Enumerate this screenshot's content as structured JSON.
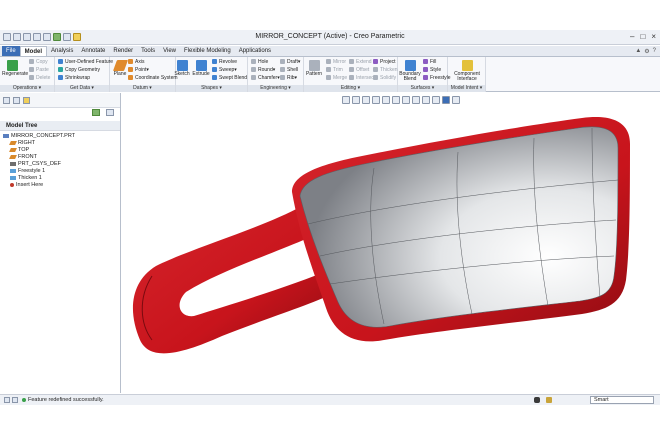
{
  "window": {
    "title": "MIRROR_CONCEPT (Active) - Creo Parametric"
  },
  "tabs": [
    {
      "label": "File"
    },
    {
      "label": "Model"
    },
    {
      "label": "Analysis"
    },
    {
      "label": "Annotate"
    },
    {
      "label": "Render"
    },
    {
      "label": "Tools"
    },
    {
      "label": "View"
    },
    {
      "label": "Flexible Modeling"
    },
    {
      "label": "Applications"
    }
  ],
  "ribbon": {
    "operations": {
      "regenerate": "Regenerate",
      "copy": "Copy",
      "paste": "Paste",
      "delete": "Delete",
      "label": "Operations"
    },
    "getdata": {
      "udf": "User-Defined Feature",
      "copygeom": "Copy Geometry",
      "shrinkwrap": "Shrinkwrap",
      "label": "Get Data"
    },
    "datum": {
      "plane": "Plane",
      "axis": "Axis",
      "point": "Point",
      "csys": "Coordinate System",
      "label": "Datum"
    },
    "shapes": {
      "sketch": "Sketch",
      "extrude": "Extrude",
      "revolve": "Revolve",
      "sweep": "Sweep",
      "sweptblend": "Swept Blend",
      "label": "Shapes"
    },
    "engineering": {
      "hole": "Hole",
      "round": "Round",
      "chamfer": "Chamfer",
      "draft": "Draft",
      "shell": "Shell",
      "rib": "Rib",
      "label": "Engineering"
    },
    "editing": {
      "pattern": "Pattern",
      "mirror": "Mirror",
      "trim": "Trim",
      "merge": "Merge",
      "extend": "Extend",
      "offset": "Offset",
      "intersect": "Intersect",
      "project": "Project",
      "thicken": "Thicken",
      "solidify": "Solidify",
      "label": "Editing"
    },
    "surfaces": {
      "boundary": "Boundary Blend",
      "fill": "Fill",
      "style": "Style",
      "freestyle": "Freestyle",
      "label": "Surfaces"
    },
    "modelintent": {
      "component": "Component Interface",
      "label": "Model Intent"
    }
  },
  "tree": {
    "header": "Model Tree",
    "items": [
      {
        "label": "MIRROR_CONCEPT.PRT",
        "icon": "part-icon",
        "color": "#5a7fbf"
      },
      {
        "label": "RIGHT",
        "icon": "datum-plane-icon",
        "color": "#d98a2b"
      },
      {
        "label": "TOP",
        "icon": "datum-plane-icon",
        "color": "#d98a2b"
      },
      {
        "label": "FRONT",
        "icon": "datum-plane-icon",
        "color": "#d98a2b"
      },
      {
        "label": "PRT_CSYS_DEF",
        "icon": "csys-icon",
        "color": "#6e6e6e"
      },
      {
        "label": "Freestyle 1",
        "icon": "freestyle-icon",
        "color": "#5aa0d8"
      },
      {
        "label": "Thicken 1",
        "icon": "thicken-icon",
        "color": "#5aa0d8"
      },
      {
        "label": "Insert Here",
        "icon": "insert-here-icon",
        "color": "#c0392b"
      }
    ]
  },
  "status": {
    "message": "Feature redefined successfully.",
    "filter": "Smart"
  },
  "colors": {
    "model_red": "#c8141c",
    "file_tab": "#3c6eb6"
  }
}
